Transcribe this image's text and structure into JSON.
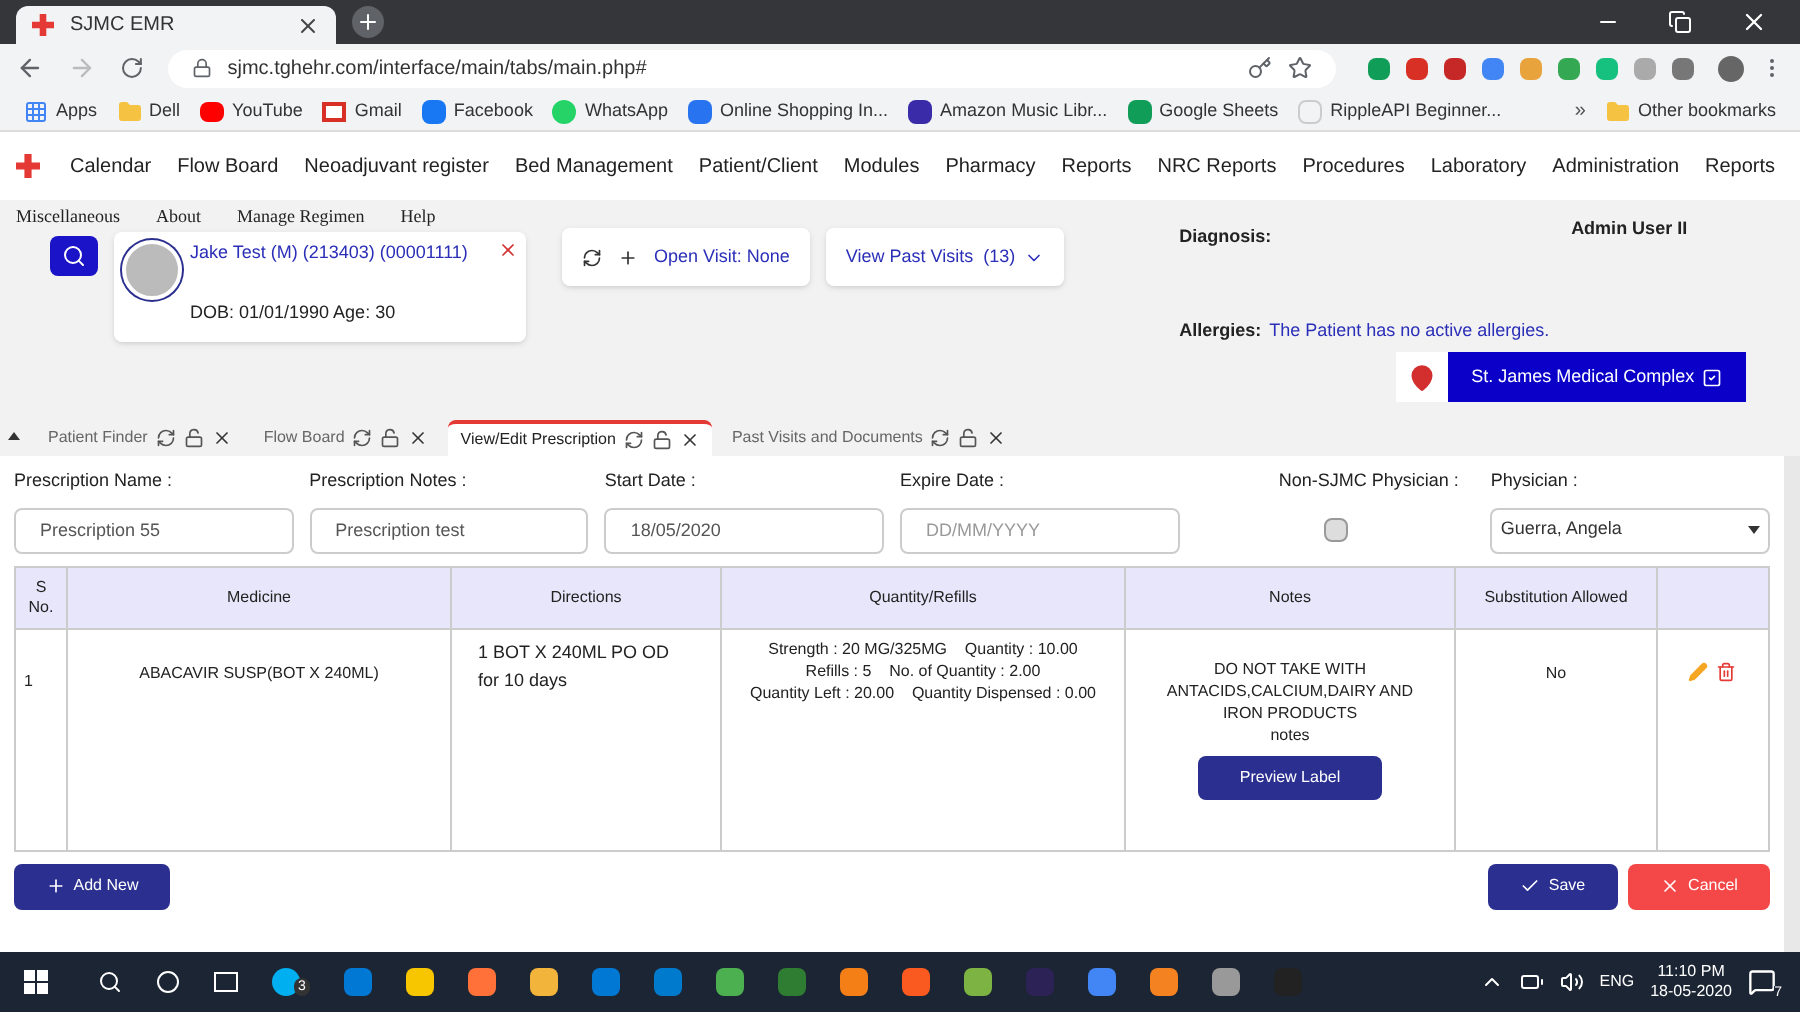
{
  "browser": {
    "tab_title": "SJMC EMR",
    "url": "sjmc.tghehr.com/interface/main/tabs/main.php#",
    "bookmarks": [
      {
        "label": "Apps",
        "kind": "apps"
      },
      {
        "label": "Dell",
        "kind": "folder"
      },
      {
        "label": "YouTube",
        "kind": "youtube"
      },
      {
        "label": "Gmail",
        "kind": "gmail"
      },
      {
        "label": "Facebook",
        "kind": "facebook"
      },
      {
        "label": "WhatsApp",
        "kind": "whatsapp"
      },
      {
        "label": "Online Shopping In...",
        "kind": "shop"
      },
      {
        "label": "Amazon Music Libr...",
        "kind": "music"
      },
      {
        "label": "Google Sheets",
        "kind": "sheets"
      },
      {
        "label": "RippleAPI Beginner...",
        "kind": "code"
      }
    ],
    "more_bookmarks": "»",
    "other_bookmarks": "Other bookmarks"
  },
  "nav": {
    "items": [
      "Calendar",
      "Flow Board",
      "Neoadjuvant register",
      "Bed Management",
      "Patient/Client",
      "Modules",
      "Pharmacy",
      "Reports",
      "NRC Reports",
      "Procedures",
      "Laboratory",
      "Administration",
      "Reports"
    ],
    "submenu": [
      "Miscellaneous",
      "About",
      "Manage Regimen",
      "Help"
    ]
  },
  "patient": {
    "name": "Jake Test (M) (213403) (00001111)",
    "details": "DOB: 01/01/1990 Age: 30"
  },
  "open_visit": "Open Visit: None",
  "past_visits": "View Past Visits  (13)",
  "diagnosis_label": "Diagnosis:",
  "user": "Admin User II",
  "allergies_label": "Allergies:",
  "allergies_text": "The Patient has no active allergies.",
  "facility": "St. James Medical Complex",
  "tabs": [
    {
      "label": "Patient Finder",
      "selected": false
    },
    {
      "label": "Flow Board",
      "selected": false
    },
    {
      "label": "View/Edit Prescription",
      "selected": true
    },
    {
      "label": "Past Visits and Documents",
      "selected": false
    }
  ],
  "form": [
    {
      "label": "Prescription Name :",
      "kind": "text",
      "value": "Prescription 55"
    },
    {
      "label": "Prescription Notes :",
      "kind": "text",
      "value": "Prescription test"
    },
    {
      "label": "Start Date :",
      "kind": "text",
      "value": "18/05/2020"
    },
    {
      "label": "Expire Date :",
      "kind": "text",
      "placeholder": "DD/MM/YYYY"
    },
    {
      "label": "Non-SJMC Physician :",
      "kind": "checkbox",
      "checked": false
    },
    {
      "label": "Physician :",
      "kind": "select",
      "value": "Guerra, Angela"
    }
  ],
  "table": {
    "columns": [
      "S No.",
      "Medicine",
      "Directions",
      "Quantity/Refills",
      "Notes",
      "Substitution Allowed"
    ],
    "rows": [
      {
        "s_no": "1",
        "medicine": "ABACAVIR SUSP(BOT X 240ML)",
        "directions": "1 BOT X 240ML PO OD for 10 days",
        "quantity": [
          "Strength : 20 MG/325MG    Quantity : 10.00",
          "Refills : 5    No. of Quantity : 2.00",
          "Quantity Left : 20.00    Quantity Dispensed : 0.00"
        ],
        "notes": "DO NOT TAKE WITH ANTACIDS,CALCIUM,DAIRY AND IRON PRODUCTS",
        "notes_extra": "notes",
        "preview_button": "Preview Label",
        "substitution": "No"
      }
    ]
  },
  "buttons": {
    "add": "Add New",
    "save": "Save",
    "cancel": "Cancel"
  },
  "taskbar": {
    "skype_badge": "3",
    "language": "ENG",
    "time": "11:10 PM",
    "date": "18-05-2020",
    "notifications": "7"
  }
}
